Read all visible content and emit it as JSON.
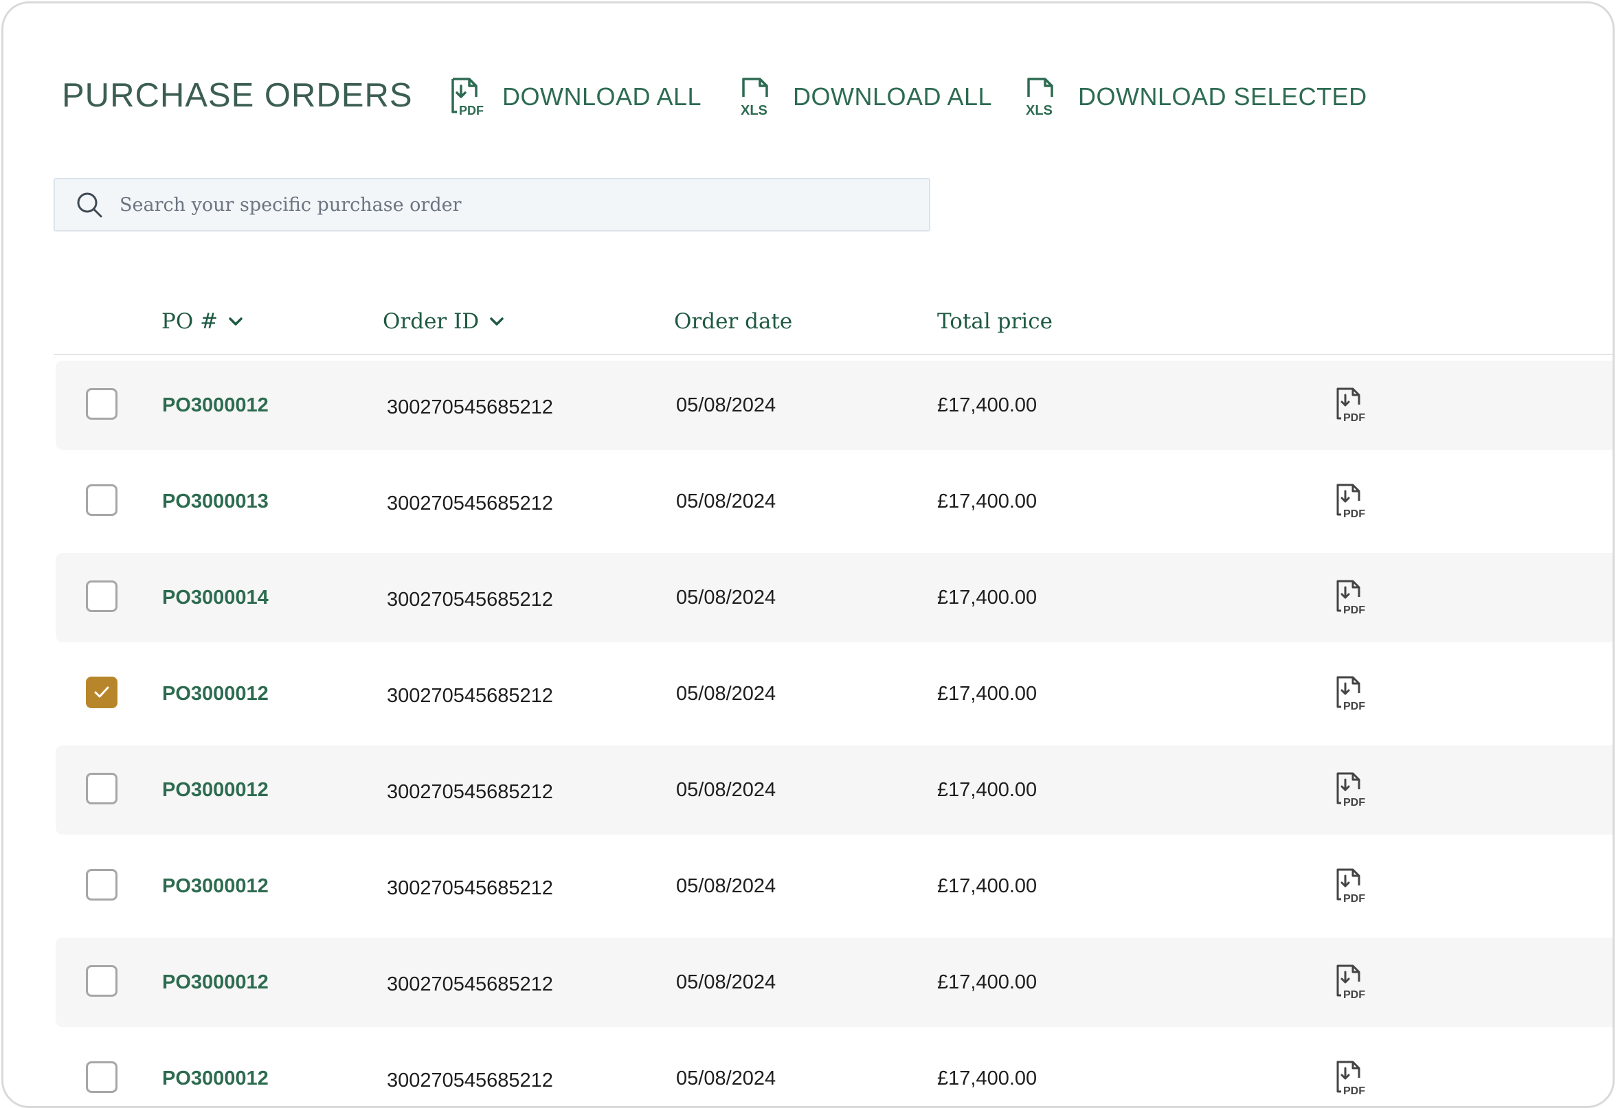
{
  "page_title": "PURCHASE ORDERS",
  "actions": [
    {
      "label": "DOWNLOAD ALL",
      "icon": "pdf-download-icon"
    },
    {
      "label": "DOWNLOAD ALL",
      "icon": "xls-download-icon"
    },
    {
      "label": "DOWNLOAD SELECTED",
      "icon": "xls-download-icon"
    }
  ],
  "search": {
    "placeholder": "Search your specific purchase order",
    "value": ""
  },
  "table": {
    "columns": {
      "po": "PO #",
      "order_id": "Order ID",
      "order_date": "Order date",
      "total_price": "Total price"
    },
    "rows": [
      {
        "po": "PO3000012",
        "order_id": "300270545685212",
        "date": "05/08/2024",
        "price": "£17,400.00",
        "checked": false
      },
      {
        "po": "PO3000013",
        "order_id": "300270545685212",
        "date": "05/08/2024",
        "price": "£17,400.00",
        "checked": false
      },
      {
        "po": "PO3000014",
        "order_id": "300270545685212",
        "date": "05/08/2024",
        "price": "£17,400.00",
        "checked": false
      },
      {
        "po": "PO3000012",
        "order_id": "300270545685212",
        "date": "05/08/2024",
        "price": "£17,400.00",
        "checked": true
      },
      {
        "po": "PO3000012",
        "order_id": "300270545685212",
        "date": "05/08/2024",
        "price": "£17,400.00",
        "checked": false
      },
      {
        "po": "PO3000012",
        "order_id": "300270545685212",
        "date": "05/08/2024",
        "price": "£17,400.00",
        "checked": false
      },
      {
        "po": "PO3000012",
        "order_id": "300270545685212",
        "date": "05/08/2024",
        "price": "£17,400.00",
        "checked": false
      },
      {
        "po": "PO3000012",
        "order_id": "300270545685212",
        "date": "05/08/2024",
        "price": "£17,400.00",
        "checked": false
      }
    ]
  },
  "colors": {
    "title": "#3c5e52",
    "accent_green": "#2d6b52",
    "checkbox_checked": "#b8862a",
    "row_shade": "#f6f6f6"
  }
}
